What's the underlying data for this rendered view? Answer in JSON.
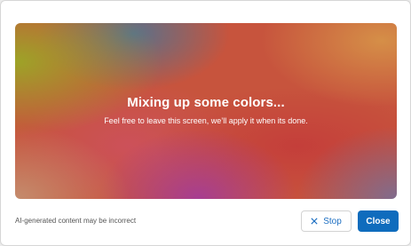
{
  "preview": {
    "title": "Mixing up some colors...",
    "subtitle": "Feel free to leave this screen, we’ll apply it when its done."
  },
  "footer": {
    "disclaimer": "AI-generated content may be incorrect",
    "stop_label": "Stop",
    "stop_icon": "close-x-icon",
    "close_label": "Close"
  },
  "colors": {
    "primary": "#0f6cbd",
    "link": "#1d6fc2",
    "gradient_colors": [
      "#9ba826",
      "#4676a0",
      "#c7543d",
      "#a53c96",
      "#d69248",
      "#786e96"
    ]
  }
}
